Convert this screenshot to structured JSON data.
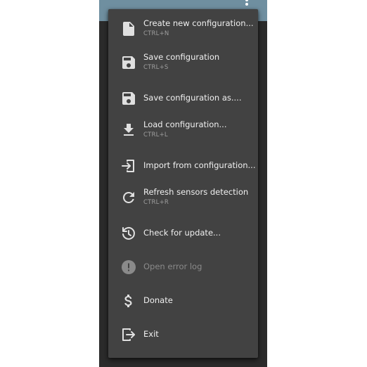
{
  "colors": {
    "toolbar": "#6f8fa0",
    "menu_background": "#424242",
    "text": "#f0f0f0",
    "shortcut_text": "#9e9e9e",
    "disabled_text": "#8a8a8a",
    "icon": "#e0e0e0",
    "disabled_icon": "#8a8a8a"
  },
  "menu": {
    "items": [
      {
        "label": "Create new configuration...",
        "shortcut": "CTRL+N",
        "icon": "file-icon",
        "enabled": true
      },
      {
        "label": "Save configuration",
        "shortcut": "CTRL+S",
        "icon": "floppy-disk-icon",
        "enabled": true
      },
      {
        "label": "Save configuration as....",
        "shortcut": "",
        "icon": "floppy-disk-icon",
        "enabled": true
      },
      {
        "label": "Load configuration...",
        "shortcut": "CTRL+L",
        "icon": "download-icon",
        "enabled": true
      },
      {
        "label": "Import from configuration...",
        "shortcut": "",
        "icon": "import-icon",
        "enabled": true
      },
      {
        "label": "Refresh sensors detection",
        "shortcut": "CTRL+R",
        "icon": "refresh-icon",
        "enabled": true
      },
      {
        "label": "Check for update...",
        "shortcut": "",
        "icon": "update-icon",
        "enabled": true
      },
      {
        "label": "Open error log",
        "shortcut": "",
        "icon": "alert-circle-icon",
        "enabled": false
      },
      {
        "label": "Donate",
        "shortcut": "",
        "icon": "dollar-icon",
        "enabled": true
      },
      {
        "label": "Exit",
        "shortcut": "",
        "icon": "exit-icon",
        "enabled": true
      }
    ]
  }
}
